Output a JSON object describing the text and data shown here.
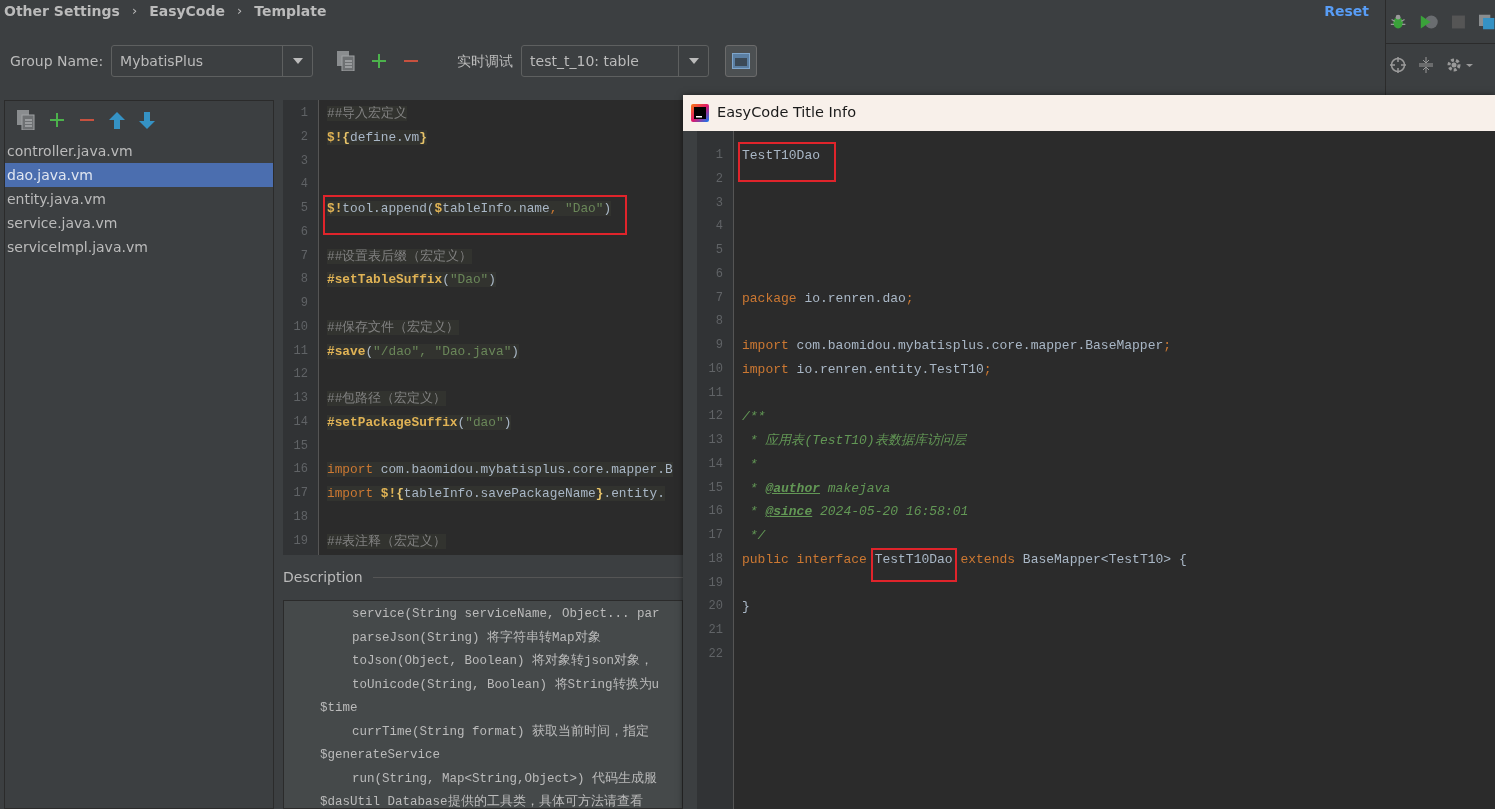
{
  "breadcrumbs": [
    {
      "kind": "crumb",
      "text": "Other Settings"
    },
    {
      "kind": "separator",
      "text": "›"
    },
    {
      "kind": "crumb",
      "text": "EasyCode"
    },
    {
      "kind": "separator",
      "text": "›"
    },
    {
      "kind": "crumb",
      "text": "Template"
    }
  ],
  "reset_link": "Reset",
  "group_name": {
    "label": "Group Name:",
    "value": "MybatisPlus"
  },
  "debug": {
    "label": "实时调试",
    "value": "test_t_10: table"
  },
  "templates": [
    {
      "name": "controller.java.vm",
      "selected": false
    },
    {
      "name": "dao.java.vm",
      "selected": true
    },
    {
      "name": "entity.java.vm",
      "selected": false
    },
    {
      "name": "service.java.vm",
      "selected": false
    },
    {
      "name": "serviceImpl.java.vm",
      "selected": false
    }
  ],
  "editor": {
    "lines": [
      {
        "number": "1",
        "tokens": [
          {
            "kind": "comment",
            "text": "##导入宏定义"
          }
        ]
      },
      {
        "number": "2",
        "tokens": [
          {
            "kind": "macro",
            "text": "$!"
          },
          {
            "kind": "brace",
            "text": "{"
          },
          {
            "kind": "plain",
            "text": "define.vm"
          },
          {
            "kind": "brace",
            "text": "}"
          }
        ]
      },
      {
        "number": "3"
      },
      {
        "number": "4"
      },
      {
        "number": "5",
        "boxed": true,
        "tokens": [
          {
            "kind": "macro",
            "text": "$!"
          },
          {
            "kind": "plain",
            "text": "tool.append("
          },
          {
            "kind": "macro",
            "text": "$"
          },
          {
            "kind": "plain",
            "text": "tableInfo.name"
          },
          {
            "kind": "keyword",
            "text": ", "
          },
          {
            "kind": "string",
            "text": "\"Dao\""
          },
          {
            "kind": "plain",
            "text": ")"
          }
        ]
      },
      {
        "number": "6"
      },
      {
        "number": "7",
        "tokens": [
          {
            "kind": "comment",
            "text": "##设置表后缀（宏定义）"
          }
        ]
      },
      {
        "number": "8",
        "tokens": [
          {
            "kind": "macro",
            "text": "#setTableSuffix"
          },
          {
            "kind": "plain",
            "text": "("
          },
          {
            "kind": "string",
            "text": "\"Dao\""
          },
          {
            "kind": "plain",
            "text": ")"
          }
        ]
      },
      {
        "number": "9"
      },
      {
        "number": "10",
        "tokens": [
          {
            "kind": "comment",
            "text": "##保存文件（宏定义）"
          }
        ]
      },
      {
        "number": "11",
        "tokens": [
          {
            "kind": "macro",
            "text": "#save"
          },
          {
            "kind": "plain",
            "text": "("
          },
          {
            "kind": "string",
            "text": "\"/dao\", \"Dao.java\""
          },
          {
            "kind": "plain",
            "text": ")"
          }
        ]
      },
      {
        "number": "12"
      },
      {
        "number": "13",
        "tokens": [
          {
            "kind": "comment",
            "text": "##包路径（宏定义）"
          }
        ]
      },
      {
        "number": "14",
        "tokens": [
          {
            "kind": "macro",
            "text": "#setPackageSuffix"
          },
          {
            "kind": "plain",
            "text": "("
          },
          {
            "kind": "string",
            "text": "\"dao\""
          },
          {
            "kind": "plain",
            "text": ")"
          }
        ]
      },
      {
        "number": "15"
      },
      {
        "number": "16",
        "tokens": [
          {
            "kind": "keyword",
            "text": "import"
          },
          {
            "kind": "plain",
            "text": " com.baomidou.mybatisplus.core.mapper.B"
          }
        ]
      },
      {
        "number": "17",
        "tokens": [
          {
            "kind": "keyword",
            "text": "import "
          },
          {
            "kind": "macro",
            "text": "$!"
          },
          {
            "kind": "brace",
            "text": "{"
          },
          {
            "kind": "plain",
            "text": "tableInfo.savePackageName"
          },
          {
            "kind": "brace",
            "text": "}"
          },
          {
            "kind": "plain",
            "text": ".entity."
          }
        ]
      },
      {
        "number": "18"
      },
      {
        "number": "19",
        "tokens": [
          {
            "kind": "comment",
            "text": "##表注释（宏定义）"
          }
        ]
      }
    ]
  },
  "description": {
    "title": "Description",
    "lines": [
      {
        "kind": "member",
        "text": "service(String serviceName, Object... par"
      },
      {
        "kind": "member",
        "text": "parseJson(String) 将字符串转Map对象"
      },
      {
        "kind": "member",
        "text": "toJson(Object, Boolean) 将对象转json对象，"
      },
      {
        "kind": "member",
        "text": "toUnicode(String, Boolean) 将String转换为u"
      },
      {
        "kind": "variable",
        "text": "$time"
      },
      {
        "kind": "member",
        "text": "currTime(String format) 获取当前时间，指定"
      },
      {
        "kind": "variable",
        "text": "$generateService"
      },
      {
        "kind": "member",
        "text": "run(String, Map<String,Object>) 代码生成服"
      },
      {
        "kind": "variable",
        "text": "$dasUtil Database提供的工具类，具体可方法请查看"
      }
    ]
  },
  "popup": {
    "title": "EasyCode Title Info",
    "lines": [
      {
        "number": "1",
        "boxed": true,
        "tokens": [
          {
            "kind": "plain",
            "text": "TestT10Dao"
          }
        ]
      },
      {
        "number": "2"
      },
      {
        "number": "3"
      },
      {
        "number": "4"
      },
      {
        "number": "5"
      },
      {
        "number": "6"
      },
      {
        "number": "7",
        "tokens": [
          {
            "kind": "keyword",
            "text": "package"
          },
          {
            "kind": "plain",
            "text": " io.renren.dao"
          },
          {
            "kind": "keyword",
            "text": ";"
          }
        ]
      },
      {
        "number": "8"
      },
      {
        "number": "9",
        "tokens": [
          {
            "kind": "keyword",
            "text": "import"
          },
          {
            "kind": "plain",
            "text": " com.baomidou.mybatisplus.core.mapper.BaseMapper"
          },
          {
            "kind": "keyword",
            "text": ";"
          }
        ]
      },
      {
        "number": "10",
        "tokens": [
          {
            "kind": "keyword",
            "text": "import"
          },
          {
            "kind": "plain",
            "text": " io.renren.entity.TestT10"
          },
          {
            "kind": "keyword",
            "text": ";"
          }
        ]
      },
      {
        "number": "11"
      },
      {
        "number": "12",
        "tokens": [
          {
            "kind": "doc",
            "text": "/**"
          }
        ]
      },
      {
        "number": "13",
        "tokens": [
          {
            "kind": "doc",
            "text": " * 应用表(TestT10)表数据库访问层"
          }
        ]
      },
      {
        "number": "14",
        "tokens": [
          {
            "kind": "doc",
            "text": " *"
          }
        ]
      },
      {
        "number": "15",
        "tokens": [
          {
            "kind": "doc",
            "text": " * "
          },
          {
            "kind": "doctag",
            "text": "@author"
          },
          {
            "kind": "doc",
            "text": " makejava"
          }
        ]
      },
      {
        "number": "16",
        "tokens": [
          {
            "kind": "doc",
            "text": " * "
          },
          {
            "kind": "doctag",
            "text": "@since"
          },
          {
            "kind": "doc",
            "text": " 2024-05-20 16:58:01"
          }
        ]
      },
      {
        "number": "17",
        "tokens": [
          {
            "kind": "doc",
            "text": " */"
          }
        ]
      },
      {
        "number": "18",
        "tokens": [
          {
            "kind": "keyword",
            "text": "public interface "
          },
          {
            "kind": "plain",
            "text": "TestT10Dao",
            "boxed": true
          },
          {
            "kind": "keyword",
            "text": " extends "
          },
          {
            "kind": "plain",
            "text": "BaseMapper<TestT10> {"
          }
        ]
      },
      {
        "number": "19"
      },
      {
        "number": "20",
        "tokens": [
          {
            "kind": "plain",
            "text": "}"
          }
        ]
      },
      {
        "number": "21"
      },
      {
        "number": "22"
      }
    ]
  }
}
